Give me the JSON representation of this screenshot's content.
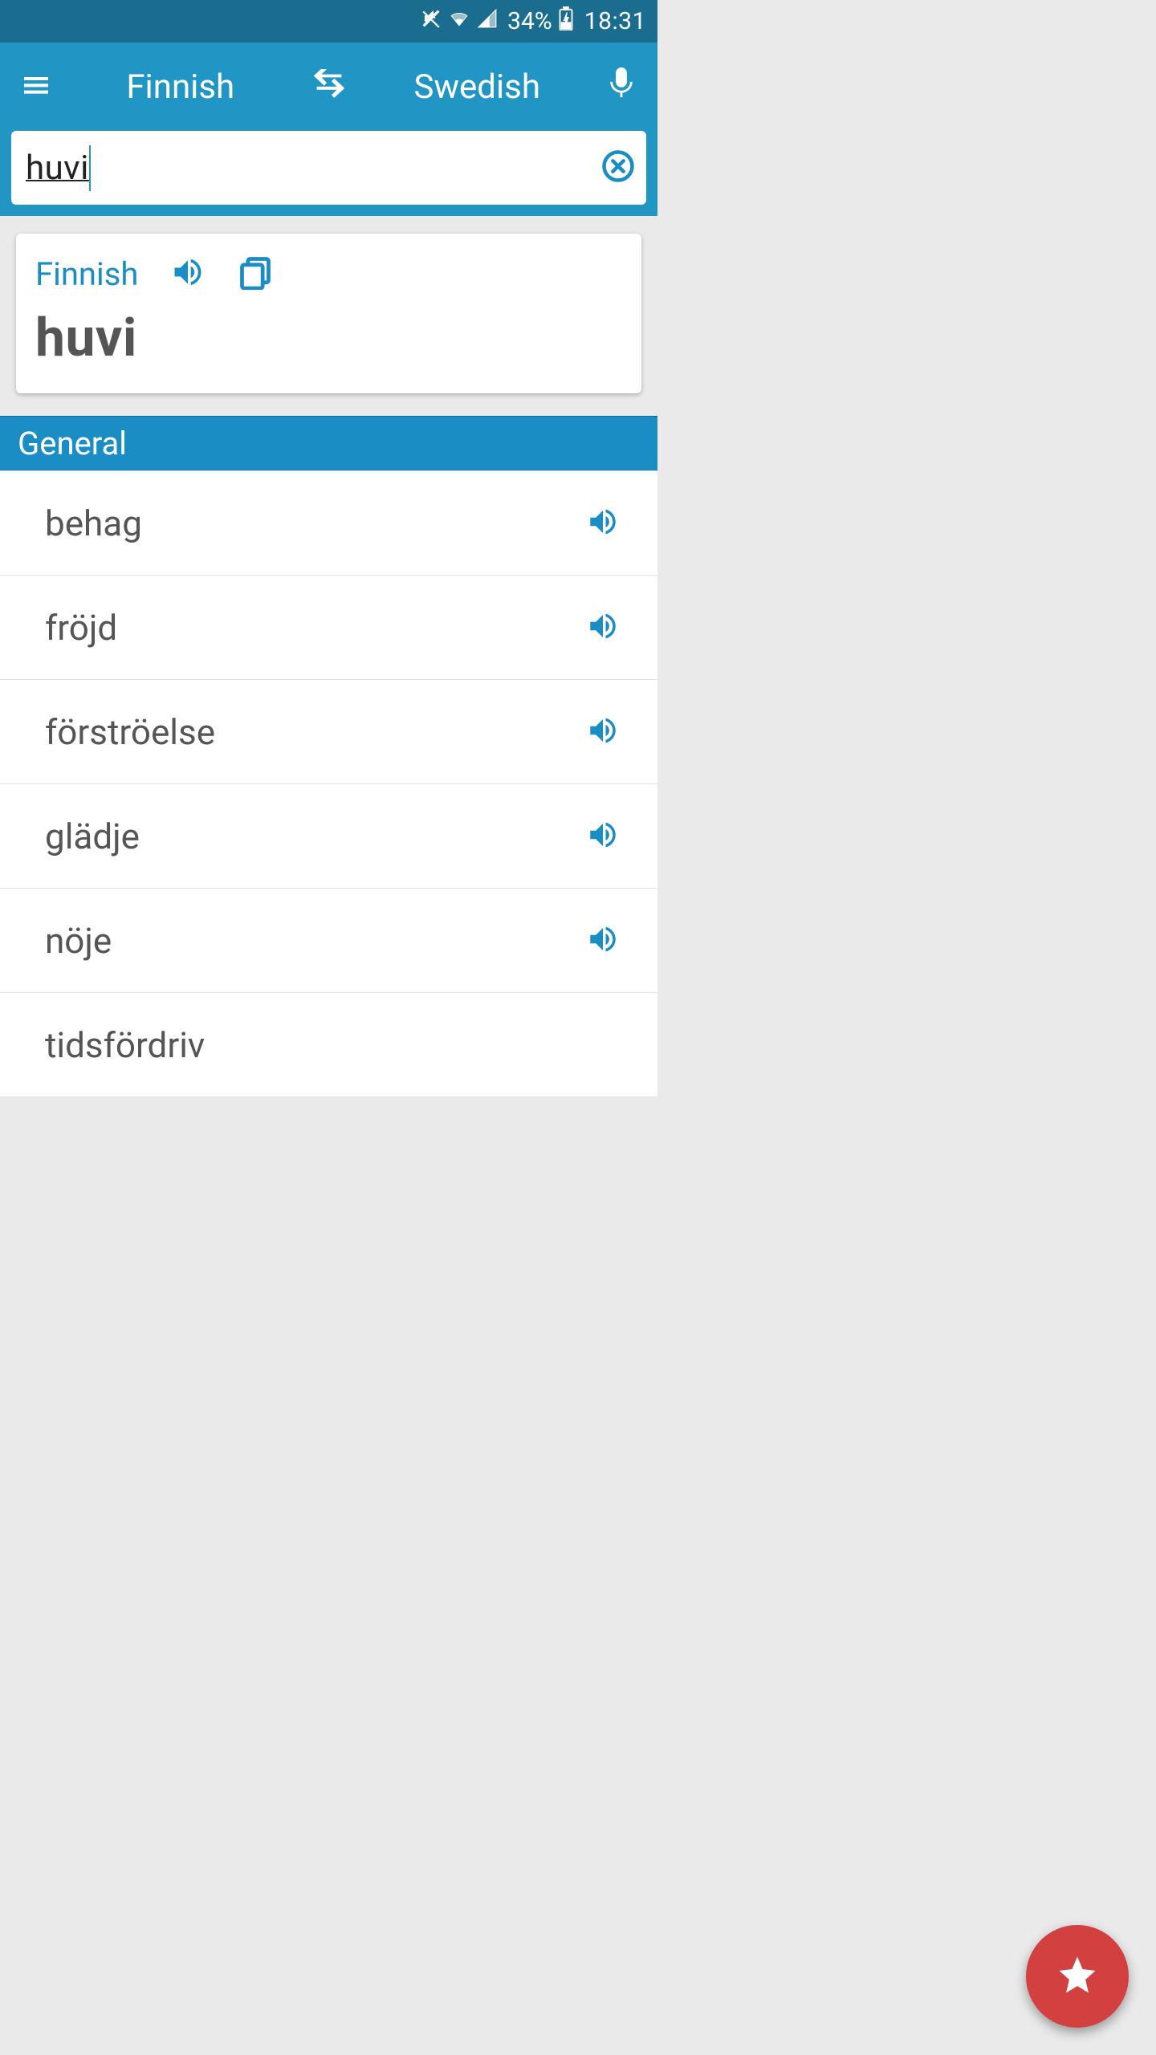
{
  "status": {
    "battery": "34%",
    "time": "18:31"
  },
  "header": {
    "source_lang": "Finnish",
    "target_lang": "Swedish"
  },
  "search": {
    "value": "huvi"
  },
  "card": {
    "lang_label": "Finnish",
    "word": "huvi"
  },
  "section": {
    "title": "General"
  },
  "results": [
    {
      "word": "behag"
    },
    {
      "word": "fröjd"
    },
    {
      "word": "förströelse"
    },
    {
      "word": "glädje"
    },
    {
      "word": "nöje"
    },
    {
      "word": "tidsfördriv"
    }
  ],
  "icons": {
    "mute": "mute-icon",
    "wifi": "wifi-icon",
    "signal": "signal-icon",
    "battery": "battery-charging-icon",
    "menu": "menu-icon",
    "swap": "swap-icon",
    "mic": "mic-icon",
    "clear": "clear-icon",
    "speaker": "speaker-icon",
    "copy": "copy-icon",
    "star": "star-icon"
  },
  "colors": {
    "status_bg": "#1a6d8f",
    "header_bg": "#2196c5",
    "accent_blue": "#1a8ec4",
    "fab_red": "#d34040",
    "text_gray": "#555555"
  }
}
